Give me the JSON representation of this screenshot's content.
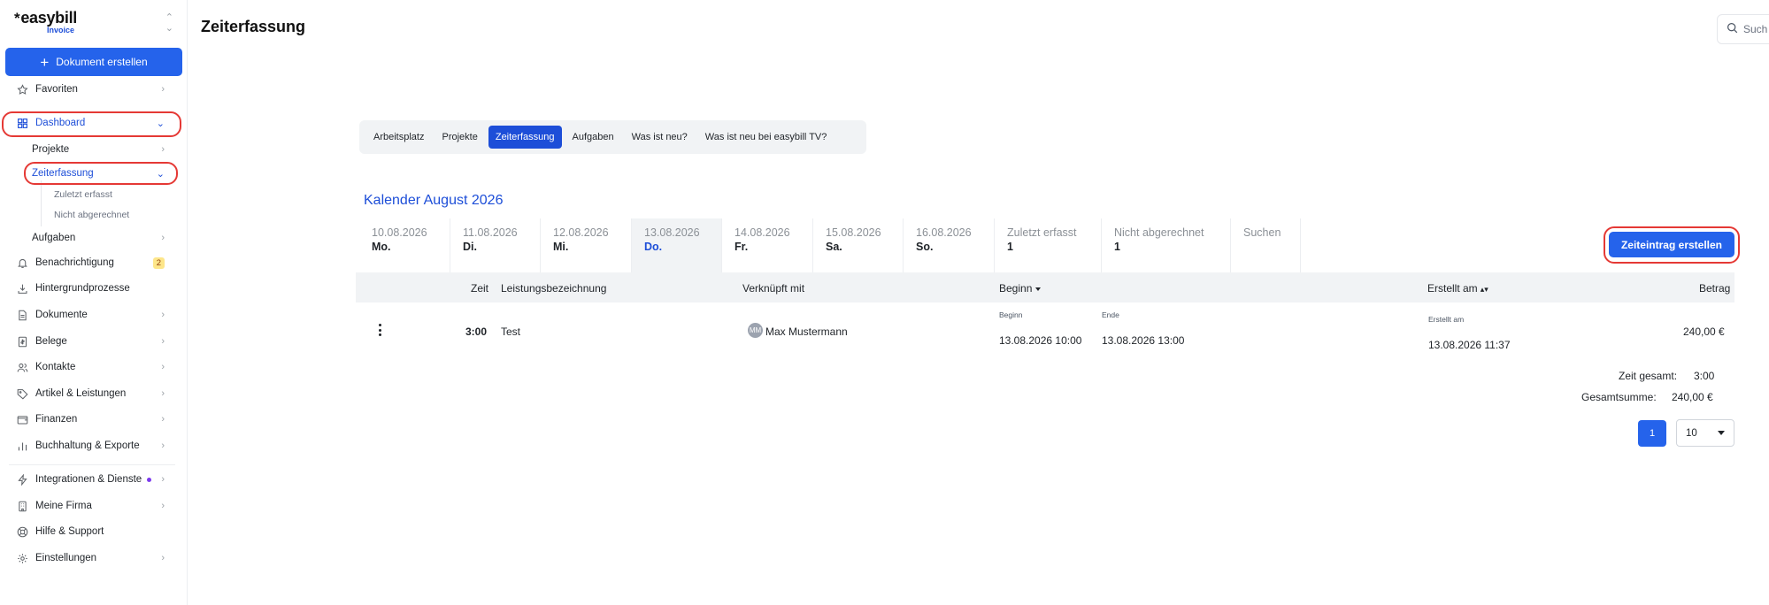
{
  "brand": {
    "name": "easybill",
    "star": "*",
    "product": "Invoice",
    "switch_icon": "updown-icon"
  },
  "sidebar": {
    "create_label": "Dokument erstellen",
    "favoriten": "Favoriten",
    "dashboard": "Dashboard",
    "dashboard_sub": {
      "projekte": "Projekte",
      "zeiterfassung": "Zeiterfassung",
      "zeiterfassung_sub": [
        "Zuletzt erfasst",
        "Nicht abgerechnet"
      ],
      "aufgaben": "Aufgaben"
    },
    "benachrichtigung": "Benachrichtigung",
    "benachrichtigung_count": "2",
    "hintergrund": "Hintergrundprozesse",
    "dokumente": "Dokumente",
    "belege": "Belege",
    "kontakte": "Kontakte",
    "artikel": "Artikel & Leistungen",
    "finanzen": "Finanzen",
    "buchhaltung": "Buchhaltung & Exporte",
    "integrationen": "Integrationen & Dienste",
    "firma": "Meine Firma",
    "hilfe": "Hilfe & Support",
    "einstellungen": "Einstellungen"
  },
  "header": {
    "title": "Zeiterfassung",
    "search_placeholder": "Such"
  },
  "tabs": [
    "Arbeitsplatz",
    "Projekte",
    "Zeiterfassung",
    "Aufgaben",
    "Was ist neu?",
    "Was ist neu bei easybill TV?"
  ],
  "active_tab": "Zeiterfassung",
  "calendar": {
    "title": "Kalender August 2026",
    "days": [
      {
        "date": "10.08.2026",
        "day": "Mo."
      },
      {
        "date": "11.08.2026",
        "day": "Di."
      },
      {
        "date": "12.08.2026",
        "day": "Mi."
      },
      {
        "date": "13.08.2026",
        "day": "Do."
      },
      {
        "date": "14.08.2026",
        "day": "Fr."
      },
      {
        "date": "15.08.2026",
        "day": "Sa."
      },
      {
        "date": "16.08.2026",
        "day": "So."
      }
    ],
    "filters": [
      {
        "label": "Zuletzt erfasst",
        "count": "1"
      },
      {
        "label": "Nicht abgerechnet",
        "count": "1"
      },
      {
        "label": "Suchen",
        "count": ""
      }
    ]
  },
  "create_entry_label": "Zeiteintrag erstellen",
  "table": {
    "headers": {
      "zeit": "Zeit",
      "leistung": "Leistungsbezeichnung",
      "verknuepft": "Verknüpft mit",
      "beginn": "Beginn",
      "erstellt": "Erstellt am",
      "betrag": "Betrag"
    },
    "row": {
      "zeit": "3:00",
      "leistung": "Test",
      "avatar": "MM",
      "kontakt": "Max Mustermann",
      "beginn_label": "Beginn",
      "beginn": "13.08.2026 10:00",
      "ende_label": "Ende",
      "ende": "13.08.2026 13:00",
      "erstellt_label": "Erstellt am",
      "erstellt": "13.08.2026 11:37",
      "betrag": "240,00 €"
    }
  },
  "totals": {
    "zeit_label": "Zeit gesamt:",
    "zeit": "3:00",
    "summe_label": "Gesamtsumme:",
    "summe": "240,00 €"
  },
  "pagination": {
    "page": "1",
    "per_page": "10"
  },
  "colors": {
    "accent": "#2563eb",
    "highlight": "#e53935"
  }
}
